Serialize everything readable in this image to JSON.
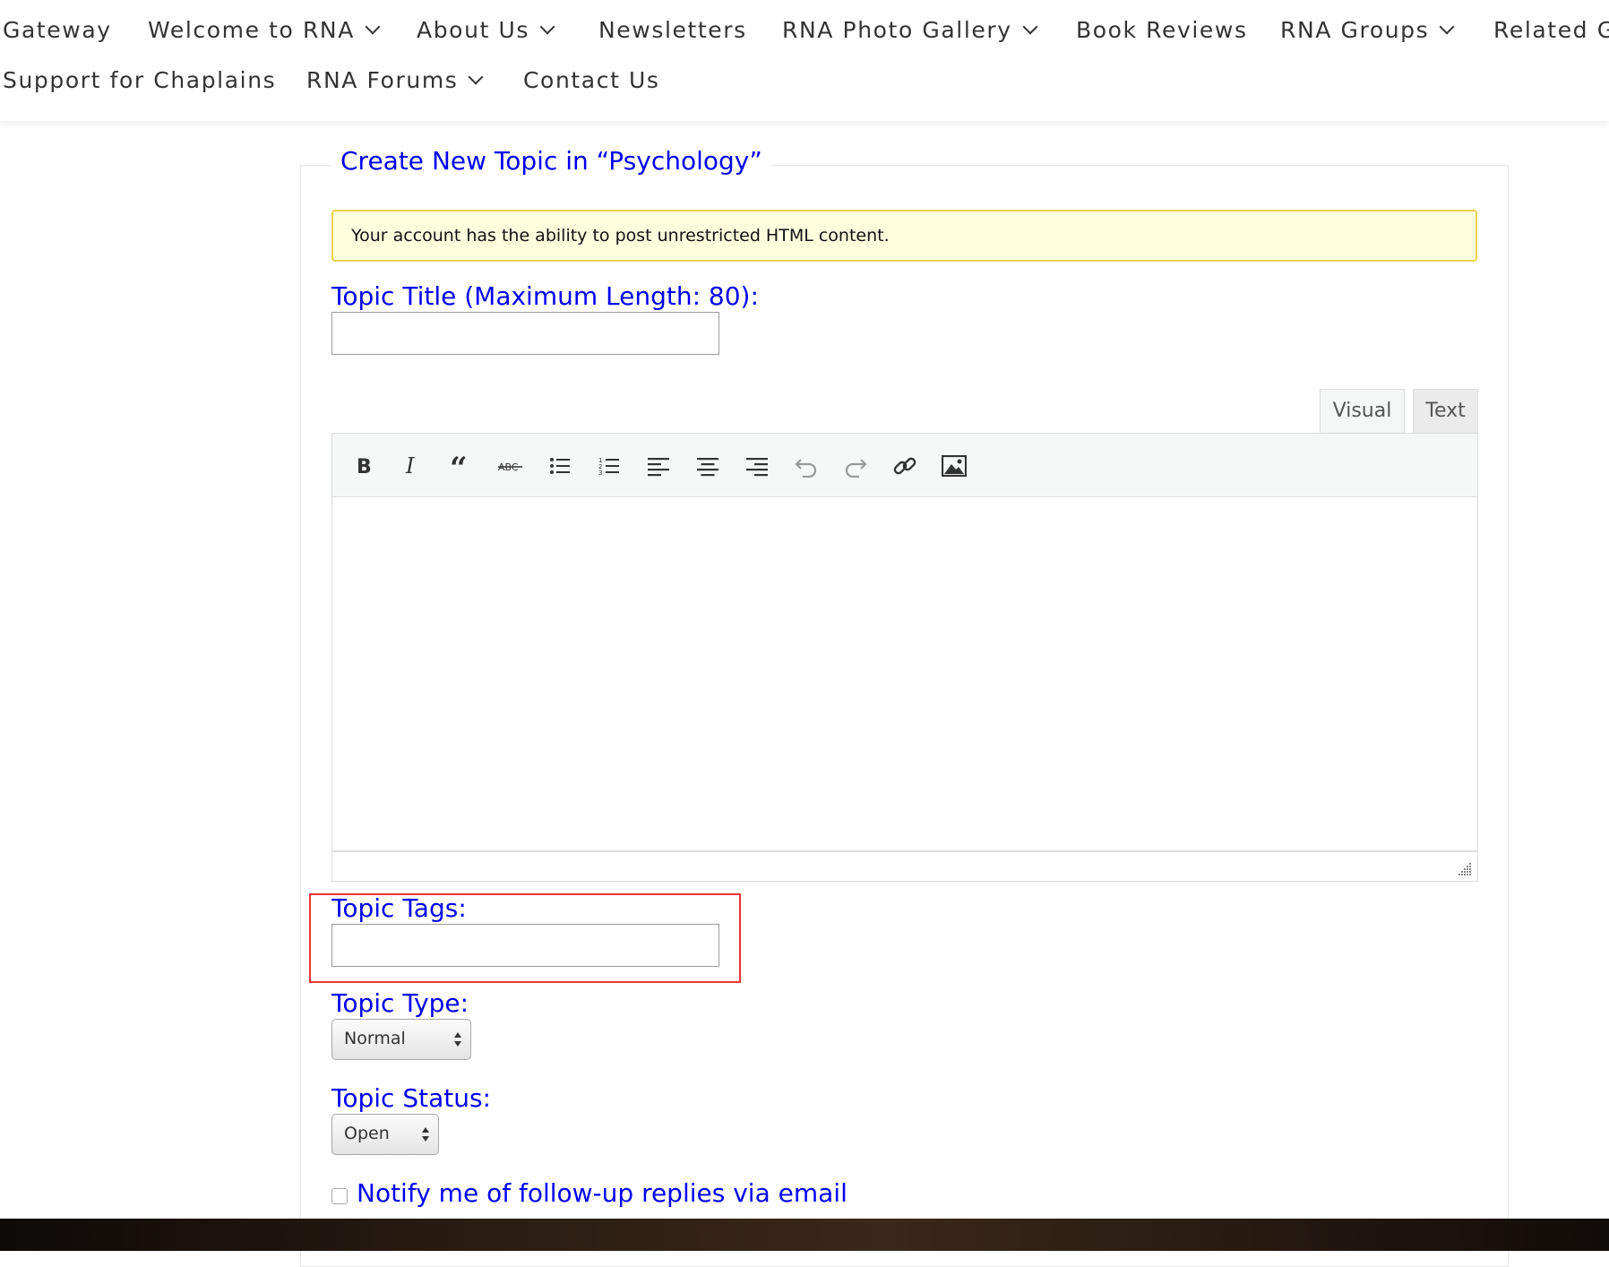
{
  "nav": {
    "row1": [
      {
        "label": "Gateway",
        "dropdown": false
      },
      {
        "label": "Welcome to RNA",
        "dropdown": true
      },
      {
        "label": "About Us",
        "dropdown": true
      },
      {
        "label": "Newsletters",
        "dropdown": false
      },
      {
        "label": "RNA Photo Gallery",
        "dropdown": true
      },
      {
        "label": "Book Reviews",
        "dropdown": false
      },
      {
        "label": "RNA Groups",
        "dropdown": true
      },
      {
        "label": "Related G",
        "dropdown": false
      }
    ],
    "row2": [
      {
        "label": "Support for Chaplains",
        "dropdown": false
      },
      {
        "label": "RNA Forums",
        "dropdown": true
      },
      {
        "label": "Contact Us",
        "dropdown": false
      }
    ]
  },
  "form": {
    "legend": "Create New Topic in “Psychology”",
    "notice": "Your account has the ability to post unrestricted HTML content.",
    "title_label": "Topic Title (Maximum Length: 80):",
    "title_value": "",
    "editor": {
      "tab_visual": "Visual",
      "tab_text": "Text",
      "toolbar": [
        "bold-icon",
        "italic-icon",
        "blockquote-icon",
        "strikethrough-icon",
        "bullet-list-icon",
        "numbered-list-icon",
        "align-left-icon",
        "align-center-icon",
        "align-right-icon",
        "undo-icon",
        "redo-icon",
        "link-icon",
        "image-icon"
      ]
    },
    "tags_label": "Topic Tags:",
    "tags_value": "",
    "type_label": "Topic Type:",
    "type_value": "Normal",
    "status_label": "Topic Status:",
    "status_value": "Open",
    "notify_label": "Notify me of follow-up replies via email",
    "notify_checked": false
  },
  "colors": {
    "label_blue": "#0000ee",
    "notice_bg": "#fffedf",
    "notice_border": "#e8d34e",
    "highlight_red": "#e8333a"
  }
}
